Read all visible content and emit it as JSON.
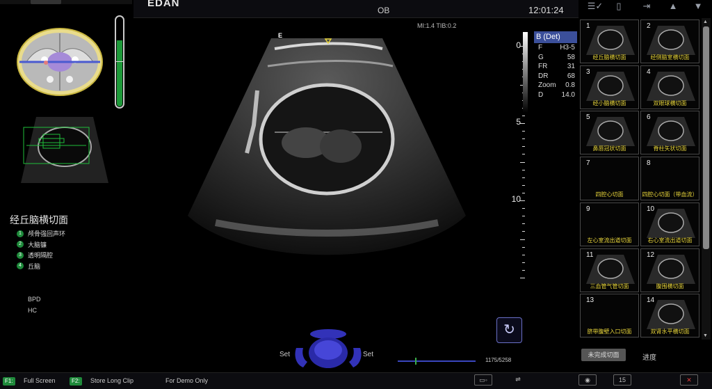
{
  "header": {
    "brand": "EDAN",
    "exam": "OB",
    "time": "12:01:24",
    "acoustic": "MI:1.4  TIB:0.2",
    "orientation_mark": "E"
  },
  "top_icons": [
    "checklist-icon",
    "phone-icon",
    "exit-icon",
    "arrow-up-icon",
    "arrow-down-icon"
  ],
  "left": {
    "plane_title": "经丘脑横切面",
    "steps": [
      {
        "num": "1",
        "label": "颅骨强回声环"
      },
      {
        "num": "2",
        "label": "大脑镰"
      },
      {
        "num": "3",
        "label": "透明隔腔"
      },
      {
        "num": "4",
        "label": "丘脑"
      }
    ],
    "measurements": [
      "BPD",
      "HC"
    ],
    "gain_level": 0.73
  },
  "depth_scale": {
    "labels": [
      "0",
      "5",
      "10"
    ],
    "unit_marker": "cm"
  },
  "params": {
    "mode": "B (Det)",
    "rows": [
      {
        "k": "F",
        "v": "H3-5"
      },
      {
        "k": "G",
        "v": "58"
      },
      {
        "k": "FR",
        "v": "31"
      },
      {
        "k": "DR",
        "v": "68"
      },
      {
        "k": "Zoom",
        "v": "0.8"
      },
      {
        "k": "D",
        "v": "14.0"
      }
    ]
  },
  "trackball": {
    "left_label": "Set",
    "right_label": "Set"
  },
  "cine": {
    "counter": "1175/5258",
    "position": 0.22
  },
  "planes": [
    {
      "num": "1",
      "caption": "经丘脑横切面",
      "has_image": true
    },
    {
      "num": "2",
      "caption": "经侧脑室横切面",
      "has_image": true
    },
    {
      "num": "3",
      "caption": "经小脑横切面",
      "has_image": true
    },
    {
      "num": "4",
      "caption": "双眼球横切面",
      "has_image": true
    },
    {
      "num": "5",
      "caption": "鼻唇冠状切面",
      "has_image": true
    },
    {
      "num": "6",
      "caption": "脊柱矢状切面",
      "has_image": true
    },
    {
      "num": "7",
      "caption": "四腔心切面",
      "has_image": false
    },
    {
      "num": "8",
      "caption": "四腔心切面（带血流）",
      "has_image": false
    },
    {
      "num": "9",
      "caption": "左心室流出道切面",
      "has_image": false
    },
    {
      "num": "10",
      "caption": "右心室流出道切面",
      "has_image": true
    },
    {
      "num": "11",
      "caption": "三血管气管切面",
      "has_image": true
    },
    {
      "num": "12",
      "caption": "腹围横切面",
      "has_image": true
    },
    {
      "num": "13",
      "caption": "脐带腹壁入口切面",
      "has_image": false
    },
    {
      "num": "14",
      "caption": "双肾水平横切面",
      "has_image": true
    }
  ],
  "right_footer": {
    "unfinished": "未完成切面",
    "progress": "进度"
  },
  "bottom": {
    "f1_key": "F1:",
    "f1_label": "Full Screen",
    "f2_key": "F2:",
    "f2_label": "Store Long Clip",
    "demo": "For Demo Only",
    "icons": [
      "network-icon",
      "usb-icon",
      "disc-icon",
      "clip-counter-icon",
      "delete-icon"
    ],
    "clip_counter": "15"
  }
}
